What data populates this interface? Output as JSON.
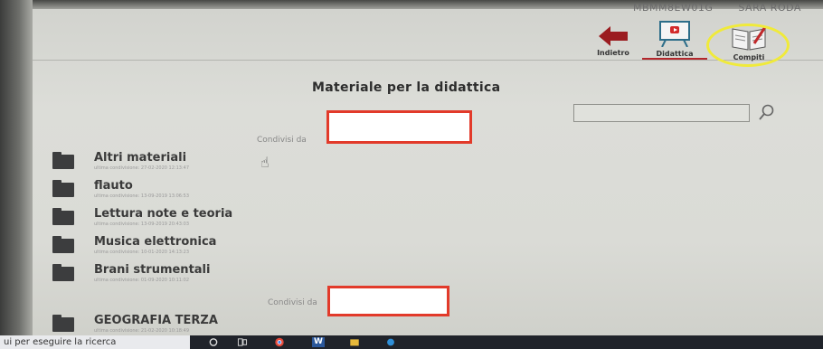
{
  "header": {
    "user_code": "MBMM8EW01G",
    "user_name": "SARA RODA",
    "nav": {
      "back_label": "Indietro",
      "didattica_label": "Didattica",
      "compiti_label": "Compiti"
    }
  },
  "main": {
    "title": "Materiale per la didattica",
    "search": {
      "value": "",
      "placeholder": ""
    },
    "groups": [
      {
        "shared_by_label": "Condivisi da",
        "folders": [
          {
            "name": "Altri materiali",
            "date": "ultima condivisione: 27-02-2020 12:13:47"
          },
          {
            "name": "flauto",
            "date": "ultima condivisione: 13-09-2019 13:06:53"
          },
          {
            "name": "Lettura note e teoria",
            "date": "ultima condivisione: 13-09-2019 20:43:03"
          },
          {
            "name": "Musica elettronica",
            "date": "ultima condivisione: 10-01-2020 14:13:23"
          },
          {
            "name": "Brani strumentali",
            "date": "ultima condivisione: 01-09-2020 10:11:02"
          }
        ]
      },
      {
        "shared_by_label": "Condivisi da",
        "folders": [
          {
            "name": "GEOGRAFIA TERZA",
            "date": "ultima condivisione: 21-02-2020 10:18:49"
          }
        ]
      }
    ]
  },
  "taskbar": {
    "search_text": "ui per eseguire la ricerca",
    "app_w": "W"
  },
  "colors": {
    "accent_red": "#b3272c",
    "highlight_yellow": "#f0ea3a",
    "redaction_border": "#e23a2a"
  }
}
